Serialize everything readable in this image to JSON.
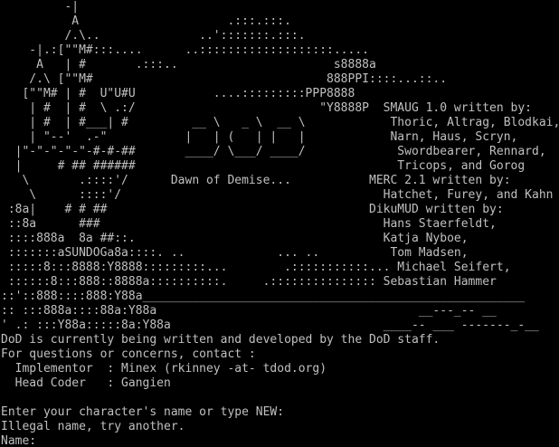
{
  "colors": {
    "background": "#000000",
    "text": "#c0c0c0"
  },
  "banner": {
    "lines": [
      "         -|",
      "          A                     .:::.:::.",
      "         /.\\..              ..':::::::.:::.",
      "    -|.:[\"\"M#:::....      ..:::::::::::::::::::.....",
      "     A   | #       .:::..                      s8888a",
      "    /.\\ [\"\"M#                                 888PPI::::...::..",
      "   [\"\"M# | #  U\"U#U           ....:::::::::PPP8888",
      "    | #  | #  \\ .:/                          \"Y8888P  SMAUG 1.0 written by:",
      "    | #  | #___| #         __ \\   _ \\  __ \\            Thoric, Altrag, Blodkai,",
      "    | \"--'  .-\"           |   | (   | |   |            Narn, Haus, Scryn,",
      "  |\"-\"-\"-\"-\"-#-#-##       ____/ \\___/ ____/             Swordbearer, Rennard,",
      "  |     # ## ######                                     Tricops, and Gorog",
      "   \\       .::::'/      Dawn of Demise...           MERC 2.1 written by:",
      "    \\      ::::'/                                     Hatchet, Furey, and Kahn",
      " :8a|    # # ##                                     DikuMUD written by:",
      " ::8a      ###                                        Hans Staerfeldt,",
      " ::::888a  8a ##::.                                   Katja Nyboe,",
      " :::::::aSUNDOGa8a::::. ..             ... ..          Tom Madsen,",
      " :::::8:::8888:Y8888:::::::::...        .:::::::::::... Michael Seifert,",
      " ::::::8:::888::8888a::::::::::.     .::::::::::::::: Sebastian Hammer",
      "::'::888::::888:Y88a______________________________________________________",
      ":: :::888a::::88a:Y88a                                     __---_-- __",
      "' .: :::Y88a:::::8a:Y88a                              ____-- ___ -------_-__"
    ]
  },
  "messages": {
    "dev_notice": "DoD is currently being written and developed by the DoD staff.",
    "contact_heading": "For questions or concerns, contact :",
    "implementor": "  Implementor  : Minex (rkinney -at- tdod.org)",
    "head_coder": "  Head Coder   : Gangien",
    "blank": "",
    "login_prompt": "Enter your character's name or type NEW:",
    "error": "Illegal name, try another."
  },
  "input": {
    "label": "Name:",
    "value": ""
  }
}
